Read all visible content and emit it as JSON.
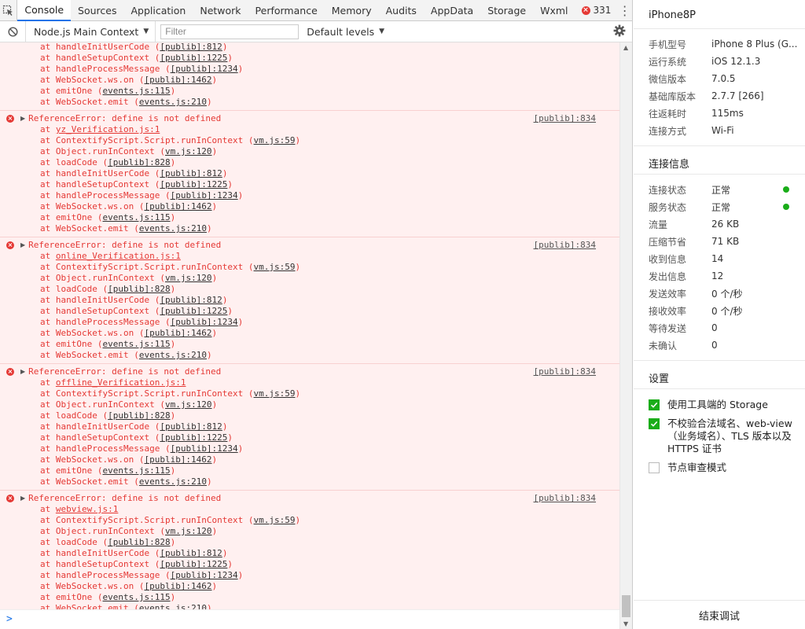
{
  "tabs": {
    "items": [
      {
        "label": "Console",
        "active": true
      },
      {
        "label": "Sources"
      },
      {
        "label": "Application"
      },
      {
        "label": "Network"
      },
      {
        "label": "Performance"
      },
      {
        "label": "Memory"
      },
      {
        "label": "Audits"
      },
      {
        "label": "AppData"
      },
      {
        "label": "Storage"
      },
      {
        "label": "Wxml"
      }
    ],
    "error_count": "331"
  },
  "filterbar": {
    "context": "Node.js Main Context",
    "filter_placeholder": "Filter",
    "levels": "Default levels"
  },
  "console": {
    "first_trace": [
      "at handleInitUserCode ([publib]:812)",
      "at handleSetupContext ([publib]:1225)",
      "at handleProcessMessage ([publib]:1234)",
      "at WebSocket.ws.on ([publib]:1462)",
      "at emitOne (events.js:115)",
      "at WebSocket.emit (events.js:210)"
    ],
    "errors": [
      {
        "message": "ReferenceError: define is not defined",
        "source": "[publib]:834",
        "frames": [
          "at yz_Verification.js:1",
          "at ContextifyScript.Script.runInContext (vm.js:59)",
          "at Object.runInContext (vm.js:120)",
          "at loadCode ([publib]:828)",
          "at handleInitUserCode ([publib]:812)",
          "at handleSetupContext ([publib]:1225)",
          "at handleProcessMessage ([publib]:1234)",
          "at WebSocket.ws.on ([publib]:1462)",
          "at emitOne (events.js:115)",
          "at WebSocket.emit (events.js:210)"
        ]
      },
      {
        "message": "ReferenceError: define is not defined",
        "source": "[publib]:834",
        "frames": [
          "at online_Verification.js:1",
          "at ContextifyScript.Script.runInContext (vm.js:59)",
          "at Object.runInContext (vm.js:120)",
          "at loadCode ([publib]:828)",
          "at handleInitUserCode ([publib]:812)",
          "at handleSetupContext ([publib]:1225)",
          "at handleProcessMessage ([publib]:1234)",
          "at WebSocket.ws.on ([publib]:1462)",
          "at emitOne (events.js:115)",
          "at WebSocket.emit (events.js:210)"
        ]
      },
      {
        "message": "ReferenceError: define is not defined",
        "source": "[publib]:834",
        "frames": [
          "at offline_Verification.js:1",
          "at ContextifyScript.Script.runInContext (vm.js:59)",
          "at Object.runInContext (vm.js:120)",
          "at loadCode ([publib]:828)",
          "at handleInitUserCode ([publib]:812)",
          "at handleSetupContext ([publib]:1225)",
          "at handleProcessMessage ([publib]:1234)",
          "at WebSocket.ws.on ([publib]:1462)",
          "at emitOne (events.js:115)",
          "at WebSocket.emit (events.js:210)"
        ]
      },
      {
        "message": "ReferenceError: define is not defined",
        "source": "[publib]:834",
        "frames": [
          "at webview.js:1",
          "at ContextifyScript.Script.runInContext (vm.js:59)",
          "at Object.runInContext (vm.js:120)",
          "at loadCode ([publib]:828)",
          "at handleInitUserCode ([publib]:812)",
          "at handleSetupContext ([publib]:1225)",
          "at handleProcessMessage ([publib]:1234)",
          "at WebSocket.ws.on ([publib]:1462)",
          "at emitOne (events.js:115)",
          "at WebSocket.emit (events.js:210)"
        ]
      }
    ],
    "prompt": ">"
  },
  "panel": {
    "device_title": "iPhone8P",
    "device_info": [
      {
        "key": "手机型号",
        "value": "iPhone 8 Plus (G..."
      },
      {
        "key": "运行系统",
        "value": "iOS 12.1.3"
      },
      {
        "key": "微信版本",
        "value": "7.0.5"
      },
      {
        "key": "基础库版本",
        "value": "2.7.7 [266]"
      },
      {
        "key": "往返耗时",
        "value": "115ms"
      },
      {
        "key": "连接方式",
        "value": "Wi-Fi"
      }
    ],
    "connection_title": "连接信息",
    "connection_info": [
      {
        "key": "连接状态",
        "value": "正常",
        "dot": true
      },
      {
        "key": "服务状态",
        "value": "正常",
        "dot": true
      },
      {
        "key": "流量",
        "value": "26 KB"
      },
      {
        "key": "压缩节省",
        "value": "71 KB"
      },
      {
        "key": "收到信息",
        "value": "14"
      },
      {
        "key": "发出信息",
        "value": "12"
      },
      {
        "key": "发送效率",
        "value": "0 个/秒"
      },
      {
        "key": "接收效率",
        "value": "0 个/秒"
      },
      {
        "key": "等待发送",
        "value": "0"
      },
      {
        "key": "未确认",
        "value": "0"
      }
    ],
    "settings_title": "设置",
    "settings": [
      {
        "label": "使用工具端的 Storage",
        "checked": true
      },
      {
        "label": "不校验合法域名、web-view（业务域名）、TLS 版本以及 HTTPS 证书",
        "checked": true
      },
      {
        "label": "节点审查模式",
        "checked": false
      }
    ],
    "end_button": "结束调试"
  },
  "colors": {
    "error_red": "#e53935",
    "error_bg": "#fff0f0",
    "accent_blue": "#1a73e8",
    "ok_green": "#1aad19"
  }
}
